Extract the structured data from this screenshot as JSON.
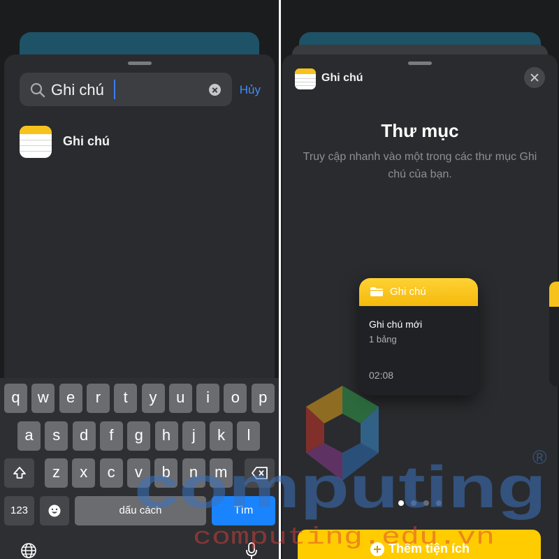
{
  "left": {
    "search": {
      "value": "Ghi chú",
      "cancel": "Hủy"
    },
    "result": {
      "label": "Ghi chú"
    },
    "keyboard": {
      "row1": [
        "q",
        "w",
        "e",
        "r",
        "t",
        "y",
        "u",
        "i",
        "o",
        "p"
      ],
      "row2": [
        "a",
        "s",
        "d",
        "f",
        "g",
        "h",
        "j",
        "k",
        "l"
      ],
      "row3": [
        "z",
        "x",
        "c",
        "v",
        "b",
        "n",
        "m"
      ],
      "numbers": "123",
      "space": "dấu cách",
      "action": "Tìm"
    }
  },
  "right": {
    "app_name": "Ghi chú",
    "title": "Thư mục",
    "description": "Truy cập nhanh vào một trong các thư mục Ghi chú của bạn.",
    "preview": {
      "folder": "Ghi chú",
      "note_title": "Ghi chú mới",
      "note_subtitle": "1 bảng",
      "time": "02:08"
    },
    "pages": {
      "total": 4,
      "active": 1
    },
    "add_button": "Thêm tiện ích"
  },
  "watermark": {
    "brand": "computing",
    "url": "computing.edu.vn",
    "mark": "®"
  },
  "colors": {
    "accent_blue": "#1a84ff",
    "notes_yellow": "#ffcc00",
    "sheet": "#2a2b2e"
  },
  "icons": [
    "search-icon",
    "clear-icon",
    "notes-app-icon",
    "close-icon",
    "folder-icon",
    "shift-icon",
    "backspace-icon",
    "emoji-icon",
    "globe-icon",
    "mic-icon",
    "plus-icon"
  ]
}
